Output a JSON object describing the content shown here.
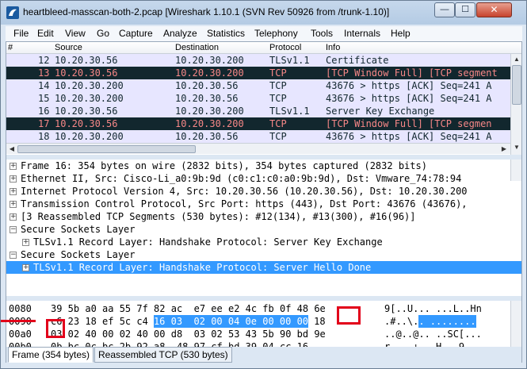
{
  "window": {
    "title": "heartbleed-masscan-both-2.pcap   [Wireshark 1.10.1  (SVN Rev 50926 from /trunk-1.10)]",
    "buttons": {
      "minimize": "—",
      "maximize": "☐",
      "close": "✕"
    }
  },
  "menu": [
    {
      "label": "File"
    },
    {
      "label": "Edit"
    },
    {
      "label": "View"
    },
    {
      "label": "Go"
    },
    {
      "label": "Capture"
    },
    {
      "label": "Analyze"
    },
    {
      "label": "Statistics"
    },
    {
      "label": "Telephony"
    },
    {
      "label": "Tools"
    },
    {
      "label": "Internals"
    },
    {
      "label": "Help"
    }
  ],
  "packet_list": {
    "columns": [
      "#",
      "Source",
      "Destination",
      "Protocol",
      "Info"
    ],
    "rows": [
      {
        "no": "12",
        "src": "10.20.30.56",
        "dst": "10.20.30.200",
        "proto": "TLSv1.1",
        "info": "Certificate",
        "style": "tls"
      },
      {
        "no": "13",
        "src": "10.20.30.56",
        "dst": "10.20.30.200",
        "proto": "TCP",
        "info": "[TCP Window Full] [TCP segment",
        "style": "bad"
      },
      {
        "no": "14",
        "src": "10.20.30.200",
        "dst": "10.20.30.56",
        "proto": "TCP",
        "info": "43676 > https [ACK] Seq=241 A",
        "style": "tcp"
      },
      {
        "no": "15",
        "src": "10.20.30.200",
        "dst": "10.20.30.56",
        "proto": "TCP",
        "info": "43676 > https [ACK] Seq=241 A",
        "style": "tcp"
      },
      {
        "no": "16",
        "src": "10.20.30.56",
        "dst": "10.20.30.200",
        "proto": "TLSv1.1",
        "info": "Server Key Exchange",
        "style": "tls"
      },
      {
        "no": "17",
        "src": "10.20.30.56",
        "dst": "10.20.30.200",
        "proto": "TCP",
        "info": "[TCP Window Full] [TCP segmen",
        "style": "bad"
      },
      {
        "no": "18",
        "src": "10.20.30.200",
        "dst": "10.20.30.56",
        "proto": "TCP",
        "info": "43676 > https [ACK] Seq=241 A",
        "style": "tcp"
      }
    ]
  },
  "details": [
    {
      "expander": "+",
      "text": "Frame 16: 354 bytes on wire (2832 bits), 354 bytes captured (2832 bits)",
      "indent": 0
    },
    {
      "expander": "+",
      "text": "Ethernet II, Src: Cisco-Li_a0:9b:9d (c0:c1:c0:a0:9b:9d), Dst: Vmware_74:78:94",
      "indent": 0
    },
    {
      "expander": "+",
      "text": "Internet Protocol Version 4, Src: 10.20.30.56 (10.20.30.56), Dst: 10.20.30.200",
      "indent": 0
    },
    {
      "expander": "+",
      "text": "Transmission Control Protocol, Src Port: https (443), Dst Port: 43676 (43676),",
      "indent": 0
    },
    {
      "expander": "+",
      "text": "[3 Reassembled TCP Segments (530 bytes): #12(134), #13(300), #16(96)]",
      "indent": 0
    },
    {
      "expander": "−",
      "text": "Secure Sockets Layer",
      "indent": 0
    },
    {
      "expander": "+",
      "text": "TLSv1.1 Record Layer: Handshake Protocol: Server Key Exchange",
      "indent": 1
    },
    {
      "expander": "−",
      "text": "Secure Sockets Layer",
      "indent": 0
    },
    {
      "expander": "+",
      "text": "TLSv1.1 Record Layer: Handshake Protocol: Server Hello Done",
      "indent": 1,
      "selected": true
    }
  ],
  "bytes": [
    {
      "offset": "0080",
      "hex_a": "39 5b a0 aa 55 7f 82 ac  e7 ee e2 4c fb 0f 48 6e",
      "hex_hl": "",
      "hex_b": "",
      "ascii": "9[..U... ...L..Hn",
      "ascii_hl": ""
    },
    {
      "offset": "0090",
      "hex_a": "c6 23 18 ef 5c c4 ",
      "hex_hl": "16 03  02 00 04 0e 00 00 00",
      "hex_b": " 18",
      "ascii": ".#..\\.",
      "ascii_hl": ". ........"
    },
    {
      "offset": "00a0",
      "hex_a": "03 02 40 00 02 40 00 d8  03 02 53 43 5b 90 bd 9e",
      "hex_hl": "",
      "hex_b": "",
      "ascii": "..@..@.. ..SC[...",
      "ascii_hl": ""
    },
    {
      "offset": "00b0",
      "hex_a": "0b bc 0c bc 2b 92 a8  48 97 cf bd 39 04 cc 16",
      "hex_hl": "",
      "hex_b": "",
      "ascii": "r....+.. H...9...",
      "ascii_hl": ""
    }
  ],
  "tabs": [
    {
      "label": "Frame (354 bytes)",
      "active": true
    },
    {
      "label": "Reassembled TCP (530 bytes)",
      "active": false
    }
  ],
  "colors": {
    "row_normal_bg": "#e7e6ff",
    "row_bad_bg": "#12272e",
    "row_bad_fg": "#f78787",
    "selection": "#3399ff",
    "annotation": "#e2001a"
  }
}
